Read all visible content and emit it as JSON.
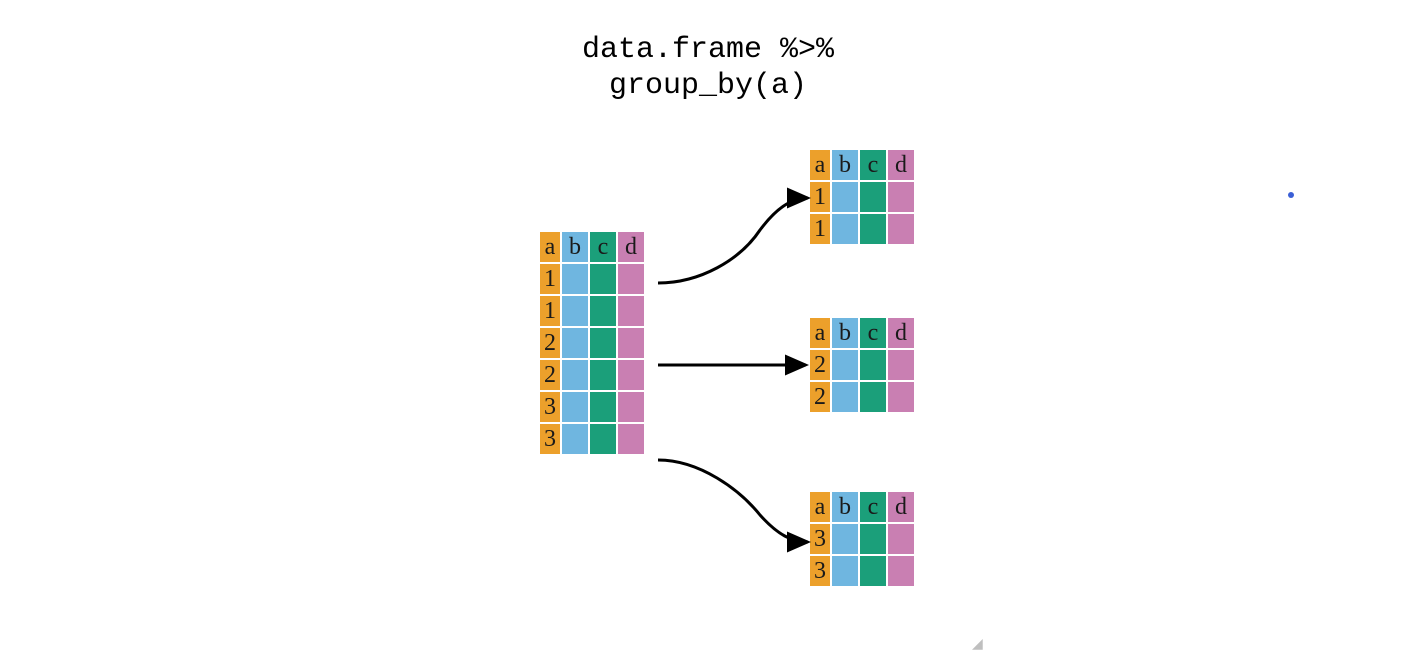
{
  "title": {
    "line1": "data.frame %>%",
    "line2": "group_by(a)"
  },
  "columns": {
    "a": "a",
    "b": "b",
    "c": "c",
    "d": "d"
  },
  "source": {
    "header": [
      "a",
      "b",
      "c",
      "d"
    ],
    "col_a_values": [
      "1",
      "1",
      "2",
      "2",
      "3",
      "3"
    ]
  },
  "groups": [
    {
      "header": [
        "a",
        "b",
        "c",
        "d"
      ],
      "col_a_values": [
        "1",
        "1"
      ]
    },
    {
      "header": [
        "a",
        "b",
        "c",
        "d"
      ],
      "col_a_values": [
        "2",
        "2"
      ]
    },
    {
      "header": [
        "a",
        "b",
        "c",
        "d"
      ],
      "col_a_values": [
        "3",
        "3"
      ]
    }
  ],
  "colors": {
    "a": "#eca02b",
    "b": "#6fb6e0",
    "c": "#1b9f7a",
    "d": "#c97fb2",
    "arrow": "#000000",
    "dot": "#3b5fd6"
  }
}
